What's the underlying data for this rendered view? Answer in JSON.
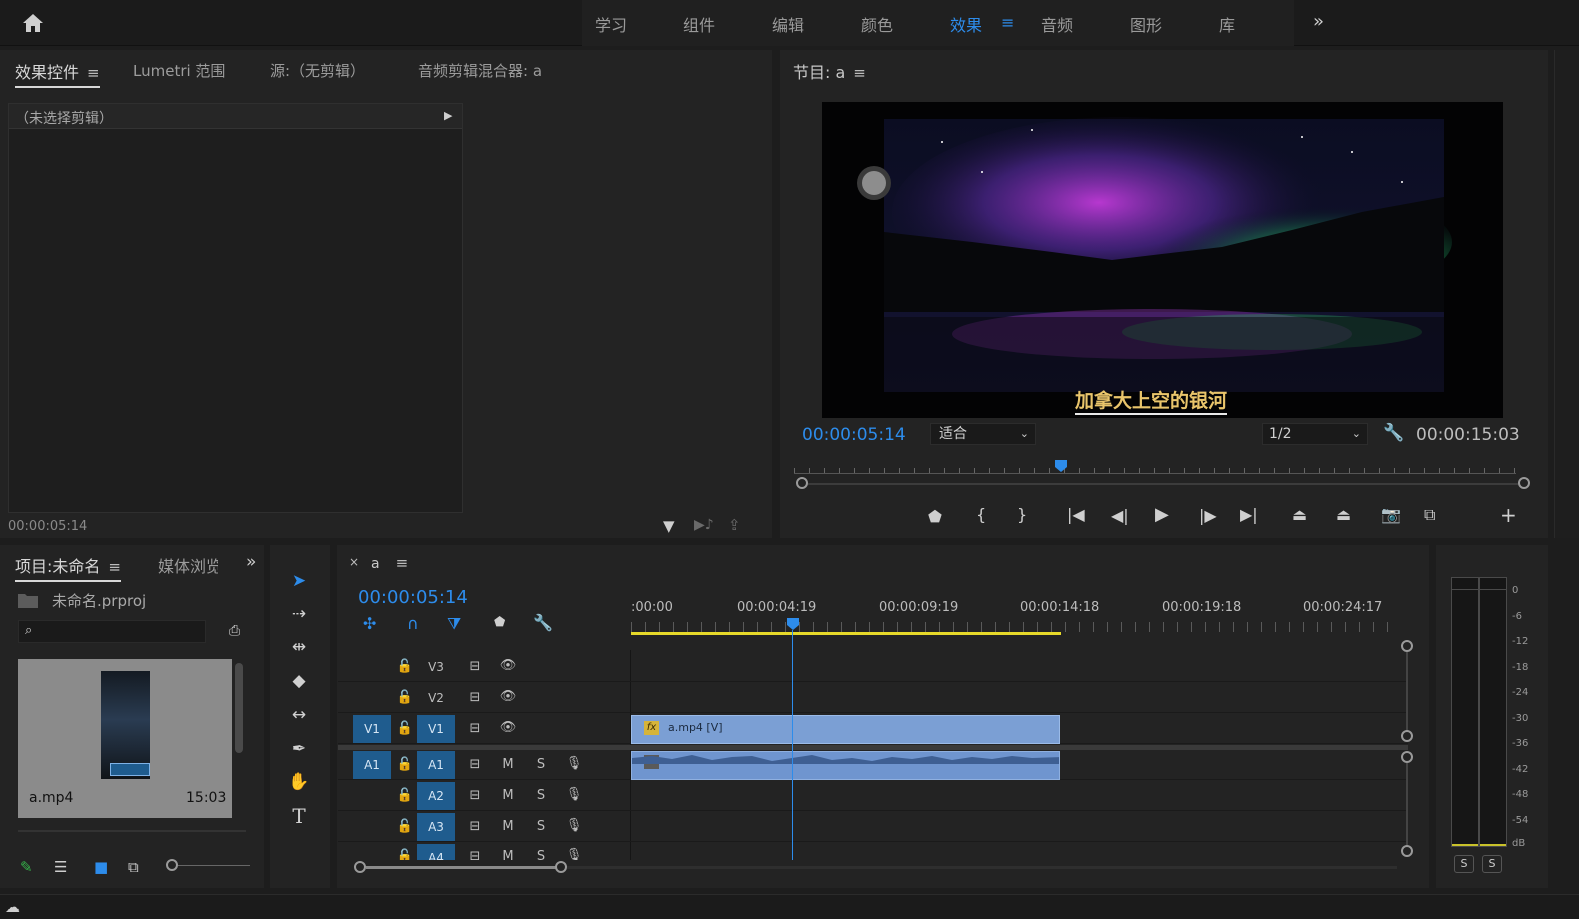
{
  "workspaces": [
    "学习",
    "组件",
    "编辑",
    "颜色",
    "效果",
    "音频",
    "图形",
    "库"
  ],
  "active_workspace_index": 4,
  "effect_panel": {
    "tabs": [
      "效果控件",
      "Lumetri 范围",
      "源:（无剪辑）",
      "音频剪辑混合器: a"
    ],
    "no_clip": "（未选择剪辑）",
    "timecode": "00:00:05:14"
  },
  "program": {
    "title": "节目: a",
    "subtitle": "加拿大上空的银河",
    "current_time": "00:00:05:14",
    "fit": "适合",
    "resolution": "1/2",
    "duration": "00:00:15:03",
    "playhead_fraction": 0.37
  },
  "project": {
    "tabs": [
      "项目:未命名",
      "媒体浏览"
    ],
    "file": "未命名.prproj",
    "search_placeholder": "",
    "clip_name": "a.mp4",
    "clip_duration": "15:03"
  },
  "timeline": {
    "sequence": "a",
    "timecode": "00:00:05:14",
    "ruler": [
      ":00:00",
      "00:00:04:19",
      "00:00:09:19",
      "00:00:14:18",
      "00:00:19:18",
      "00:00:24:17"
    ],
    "video_tracks": [
      "V3",
      "V2",
      "V1"
    ],
    "audio_tracks": [
      "A1",
      "A2",
      "A3",
      "A4"
    ],
    "source_v": "V1",
    "source_a": "A1",
    "video_clip": "a.mp4 [V]",
    "fx_label": "fx",
    "mute": "M",
    "solo": "S"
  },
  "meter": {
    "labels": [
      "0",
      "-6",
      "-12",
      "-18",
      "-24",
      "-30",
      "-36",
      "-42",
      "-48",
      "-54",
      "dB"
    ],
    "solo_buttons": [
      "S",
      "S"
    ]
  },
  "colors": {
    "accent": "#2d8ceb",
    "clip_video": "#7b9fd4",
    "clip_audio": "#6f95cf",
    "work_area": "#e6d92a"
  }
}
